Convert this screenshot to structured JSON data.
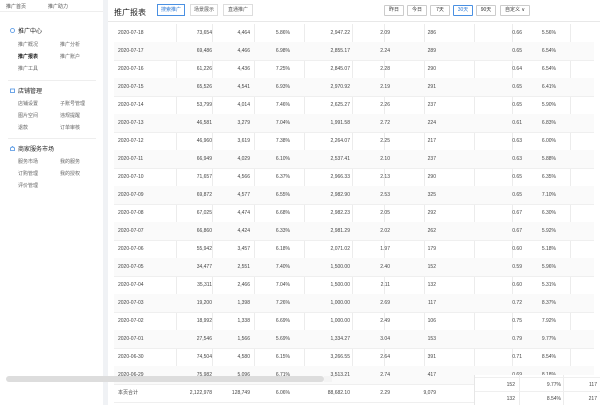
{
  "sidebar": {
    "top_links": [
      "推广首页",
      "推广助力"
    ],
    "sections": [
      {
        "title": "推广中心",
        "items": [
          "推广概况",
          "推广分析",
          "推广报表",
          "推广账户",
          "推广工具"
        ]
      },
      {
        "title": "店铺管理",
        "items": [
          "店铺设置",
          "子账号管理",
          "图片空间",
          "违规提醒",
          "退款",
          "订单审核"
        ]
      },
      {
        "title": "商家服务市场",
        "items": [
          "服务市场",
          "我的服务",
          "订购管理",
          "我的授权",
          "评价管理"
        ]
      }
    ]
  },
  "header": {
    "title": "推广报表",
    "tabs": [
      "搜索推广",
      "场景展示",
      "直通推广"
    ],
    "range_buttons": [
      "昨日",
      "今日",
      "7天",
      "30天",
      "90天",
      "自定义 ∨"
    ]
  },
  "table": {
    "rows": [
      [
        "2020-07-18",
        "73,654",
        "4,464",
        "5.86%",
        "2,947.22",
        "2.09",
        "286",
        "0.66",
        "5.56%"
      ],
      [
        "2020-07-17",
        "69,486",
        "4,466",
        "6.98%",
        "2,855.17",
        "2.24",
        "289",
        "0.65",
        "6.54%"
      ],
      [
        "2020-07-16",
        "61,226",
        "4,436",
        "7.25%",
        "2,845.07",
        "2.28",
        "290",
        "0.64",
        "6.54%"
      ],
      [
        "2020-07-15",
        "65,526",
        "4,541",
        "6.93%",
        "2,970.92",
        "2.19",
        "291",
        "0.65",
        "6.41%"
      ],
      [
        "2020-07-14",
        "53,799",
        "4,014",
        "7.46%",
        "2,625.27",
        "2.26",
        "237",
        "0.65",
        "5.90%"
      ],
      [
        "2020-07-13",
        "46,581",
        "3,279",
        "7.04%",
        "1,991.58",
        "2.72",
        "224",
        "0.61",
        "6.83%"
      ],
      [
        "2020-07-12",
        "46,960",
        "3,619",
        "7.38%",
        "2,264.07",
        "2.25",
        "217",
        "0.63",
        "6.00%"
      ],
      [
        "2020-07-11",
        "66,949",
        "4,029",
        "6.10%",
        "2,537.41",
        "2.10",
        "237",
        "0.63",
        "5.88%"
      ],
      [
        "2020-07-10",
        "71,657",
        "4,566",
        "6.37%",
        "2,966.33",
        "2.13",
        "290",
        "0.65",
        "6.35%"
      ],
      [
        "2020-07-09",
        "69,872",
        "4,577",
        "6.55%",
        "2,982.90",
        "2.53",
        "325",
        "0.65",
        "7.10%"
      ],
      [
        "2020-07-08",
        "67,025",
        "4,474",
        "6.68%",
        "2,982.23",
        "2.05",
        "292",
        "0.67",
        "6.30%"
      ],
      [
        "2020-07-07",
        "66,860",
        "4,424",
        "6.33%",
        "2,981.29",
        "2.02",
        "262",
        "0.67",
        "5.92%"
      ],
      [
        "2020-07-06",
        "55,942",
        "3,457",
        "6.18%",
        "2,071.02",
        "1.97",
        "179",
        "0.60",
        "5.18%"
      ],
      [
        "2020-07-05",
        "34,477",
        "2,551",
        "7.40%",
        "1,500.00",
        "2.40",
        "152",
        "0.59",
        "5.96%"
      ],
      [
        "2020-07-04",
        "35,311",
        "2,466",
        "7.04%",
        "1,500.00",
        "2.11",
        "132",
        "0.60",
        "5.31%"
      ],
      [
        "2020-07-03",
        "19,200",
        "1,398",
        "7.26%",
        "1,000.00",
        "2.69",
        "117",
        "0.72",
        "8.37%"
      ],
      [
        "2020-07-02",
        "18,992",
        "1,338",
        "6.69%",
        "1,000.00",
        "2.49",
        "106",
        "0.75",
        "7.92%"
      ],
      [
        "2020-07-01",
        "27,546",
        "1,566",
        "5.69%",
        "1,334.27",
        "3.04",
        "153",
        "0.79",
        "9.77%"
      ],
      [
        "2020-06-30",
        "74,504",
        "4,580",
        "6.15%",
        "3,266.55",
        "2.64",
        "391",
        "0.71",
        "8.54%"
      ],
      [
        "2020-06-29",
        "75,982",
        "5,096",
        "6.71%",
        "3,513.21",
        "2.74",
        "417",
        "0.69",
        "8.18%"
      ]
    ],
    "total": [
      "本页合计",
      "2,122,978",
      "128,749",
      "6.06%",
      "88,682.10",
      "2.29",
      "9,079",
      "0.69",
      "7.05%",
      "20"
    ]
  },
  "overflow": {
    "rows": [
      [
        "152",
        "9.77%",
        "117"
      ],
      [
        "132",
        "8.54%",
        "217"
      ]
    ]
  }
}
